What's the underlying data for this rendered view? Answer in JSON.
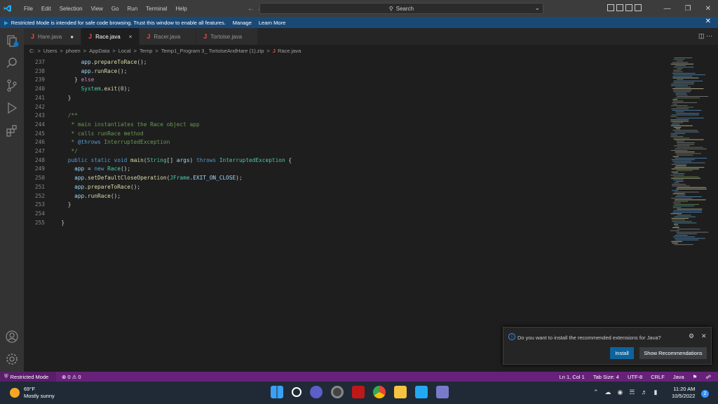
{
  "titlebar": {
    "menu": [
      "File",
      "Edit",
      "Selection",
      "View",
      "Go",
      "Run",
      "Terminal",
      "Help"
    ],
    "nav": "←  →",
    "search_placeholder": "Search"
  },
  "restricted_banner": {
    "message": "Restricted Mode is intended for safe code browsing. Trust this window to enable all features.",
    "manage": "Manage",
    "learn_more": "Learn More"
  },
  "tabs": [
    {
      "label": "Hare.java",
      "mark": "●",
      "active": false
    },
    {
      "label": "Race.java",
      "mark": "×",
      "active": true
    },
    {
      "label": "Racer.java",
      "mark": "",
      "active": false
    },
    {
      "label": "Tortoise.java",
      "mark": "",
      "active": false
    }
  ],
  "breadcrumb": [
    "C:",
    "Users",
    "phoen",
    "AppData",
    "Local",
    "Temp",
    "Temp1_Program 3_ TortoiseAndHare (1).zip",
    "Race.java"
  ],
  "editor": {
    "lines": [
      {
        "n": "237",
        "code": "        app.prepareToRace();"
      },
      {
        "n": "238",
        "code": "        app.runRace();"
      },
      {
        "n": "239",
        "code": "      } else"
      },
      {
        "n": "240",
        "code": "        System.exit(0);"
      },
      {
        "n": "241",
        "code": "    }"
      },
      {
        "n": "242",
        "code": ""
      },
      {
        "n": "243",
        "code": "    /**"
      },
      {
        "n": "244",
        "code": "     * main instantiates the Race object app"
      },
      {
        "n": "245",
        "code": "     * calls runRace method"
      },
      {
        "n": "246",
        "code": "     * @throws InterruptedException"
      },
      {
        "n": "247",
        "code": "     */"
      },
      {
        "n": "248",
        "code": "    public static void main(String[] args) throws InterruptedException {"
      },
      {
        "n": "249",
        "code": "      app = new Race();"
      },
      {
        "n": "250",
        "code": "      app.setDefaultCloseOperation(JFrame.EXIT_ON_CLOSE);"
      },
      {
        "n": "251",
        "code": "      app.prepareToRace();"
      },
      {
        "n": "252",
        "code": "      app.runRace();"
      },
      {
        "n": "253",
        "code": "    }"
      },
      {
        "n": "254",
        "code": ""
      },
      {
        "n": "255",
        "code": "  }"
      }
    ]
  },
  "notification": {
    "message": "Do you want to install the recommended extensions for Java?",
    "install": "Install",
    "show": "Show Recommendations"
  },
  "statusbar": {
    "restricted": "Restricted Mode",
    "problems": "⊗ 0 ⚠ 0",
    "position": "Ln 1, Col 1",
    "tab_size": "Tab Size: 4",
    "encoding": "UTF-8",
    "eol": "CRLF",
    "language": "Java"
  },
  "taskbar": {
    "temp": "69°F",
    "weather": "Mostly sunny",
    "time": "11:20 AM",
    "date": "10/5/2022",
    "notifications": "2"
  },
  "colors": {
    "accent": "#68217a",
    "banner": "#1a4976",
    "button": "#0e639c"
  }
}
